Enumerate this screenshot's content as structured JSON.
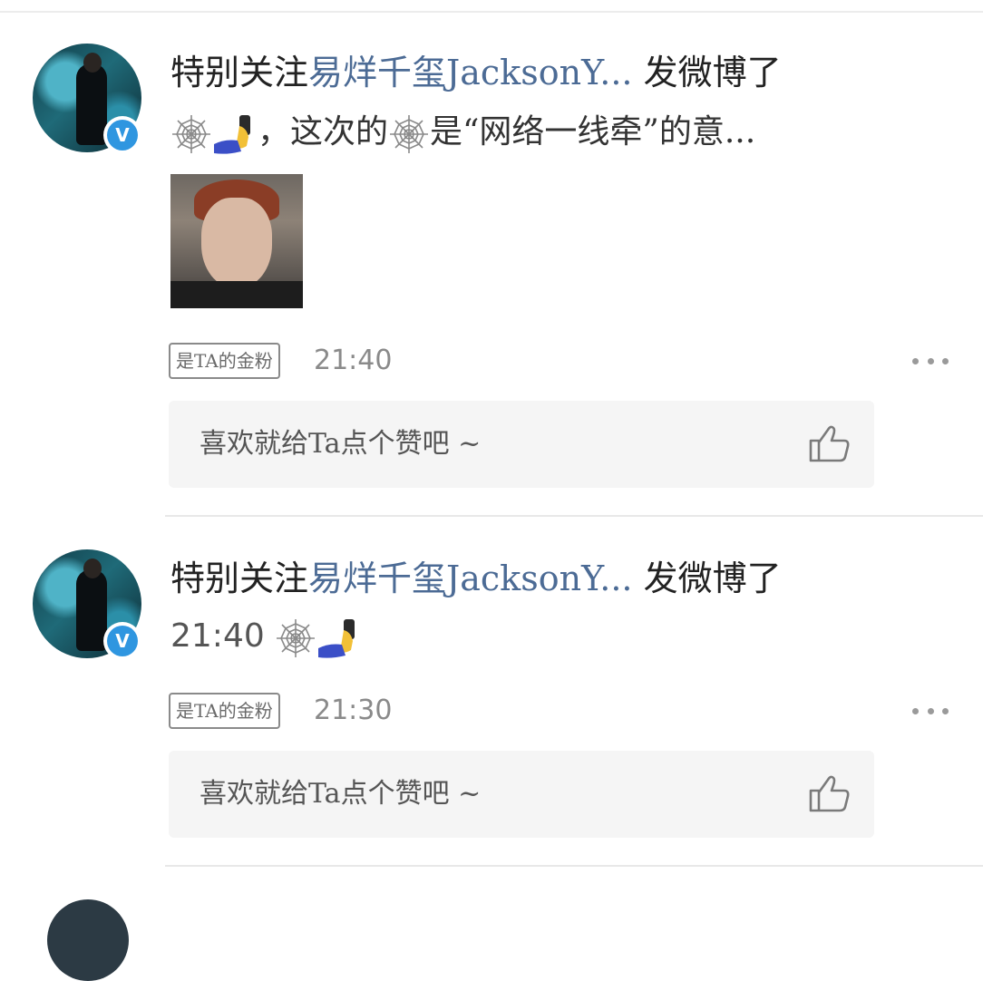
{
  "posts": [
    {
      "title_prefix": "特别关注",
      "username": "易烊千玺JacksonY...",
      "title_suffix": " 发微博了",
      "content_text": "，这次的",
      "content_text_2": "是“网络一线牵”的意...",
      "has_image": true,
      "fan_badge": "是TA的金粉",
      "time": "21:40",
      "like_prompt": "喜欢就给Ta点个赞吧 ~"
    },
    {
      "title_prefix": "特别关注",
      "username": "易烊千玺JacksonY...",
      "title_suffix": " 发微博了",
      "content_time": "21:40",
      "has_image": false,
      "fan_badge": "是TA的金粉",
      "time": "21:30",
      "like_prompt": "喜欢就给Ta点个赞吧 ~"
    }
  ],
  "icons": {
    "verify": "V",
    "web": "spider-web-icon",
    "selfie": "selfie-icon",
    "more": "more-icon",
    "like": "thumbs-up-icon"
  },
  "colors": {
    "username": "#4c6b95",
    "verify": "#2f96e0",
    "like_panel": "#f5f5f5"
  }
}
